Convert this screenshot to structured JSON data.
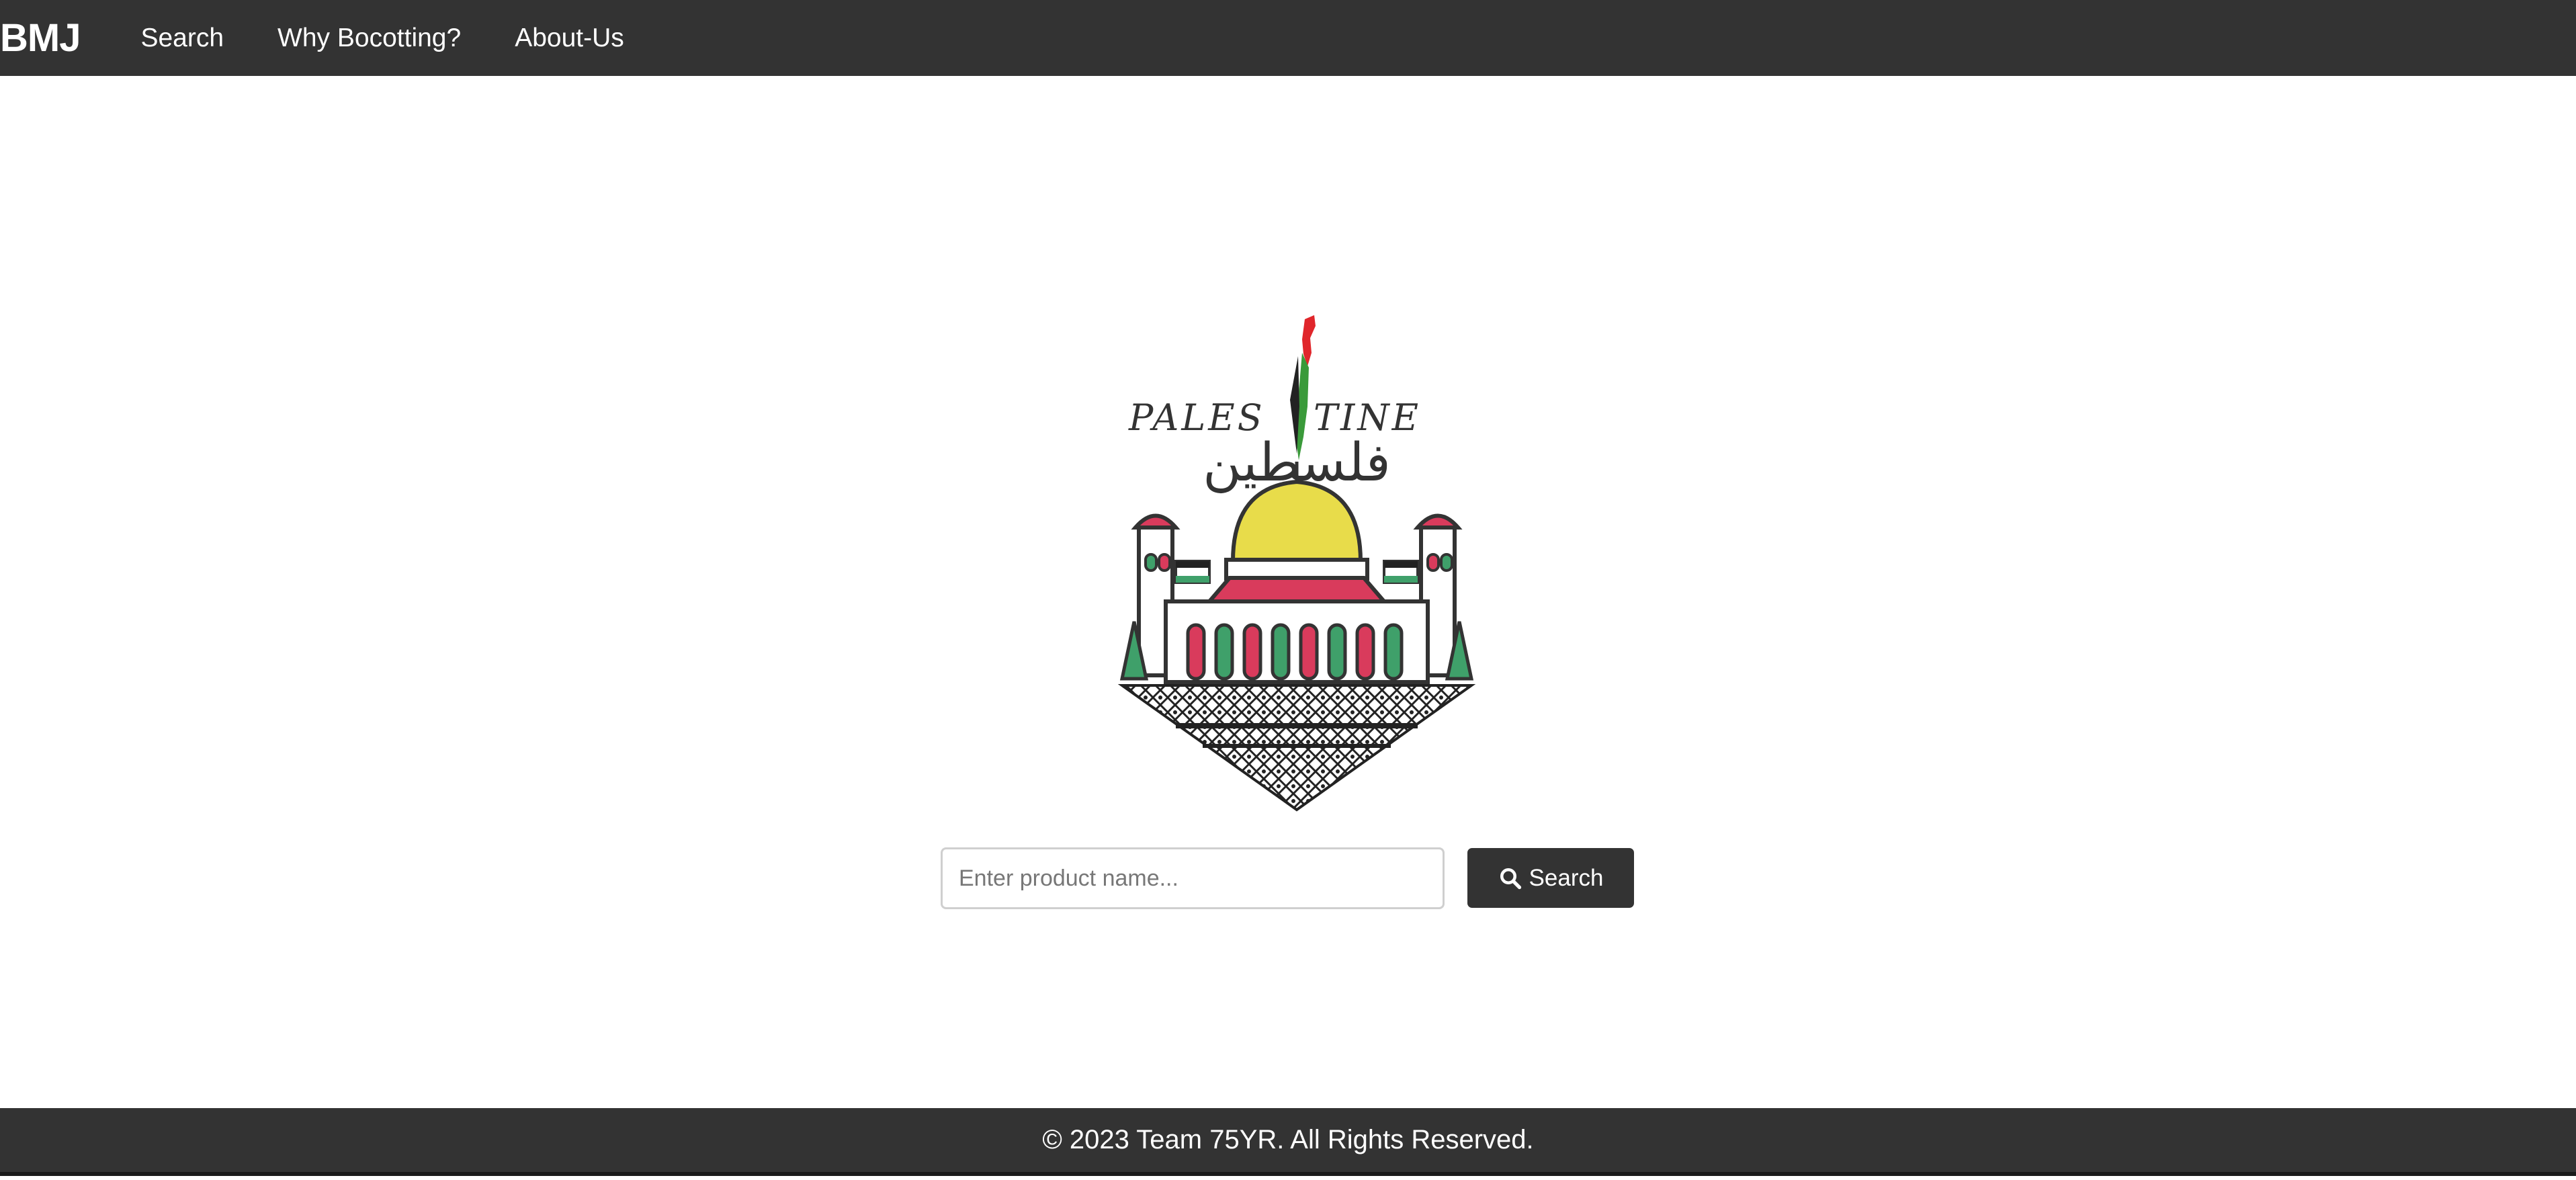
{
  "navbar": {
    "brand": "BMJ",
    "links": [
      "Search",
      "Why Bocotting?",
      "About-Us"
    ]
  },
  "logo": {
    "latin_text": "PALESTINE",
    "arabic_text": "فلسطين",
    "flag_colors": {
      "red": "#e0262b",
      "green": "#3a9a3a",
      "black": "#222222"
    },
    "dome_color": "#e8dc4a",
    "accent_pink": "#d93b5c",
    "accent_green": "#3fa06a"
  },
  "search": {
    "placeholder": "Enter product name...",
    "value": "",
    "button_label": "Search",
    "button_icon": "search-icon"
  },
  "footer": {
    "text": "© 2023 Team 75YR. All Rights Reserved."
  },
  "colors": {
    "bar_background": "#333333",
    "page_background": "#ffffff"
  }
}
